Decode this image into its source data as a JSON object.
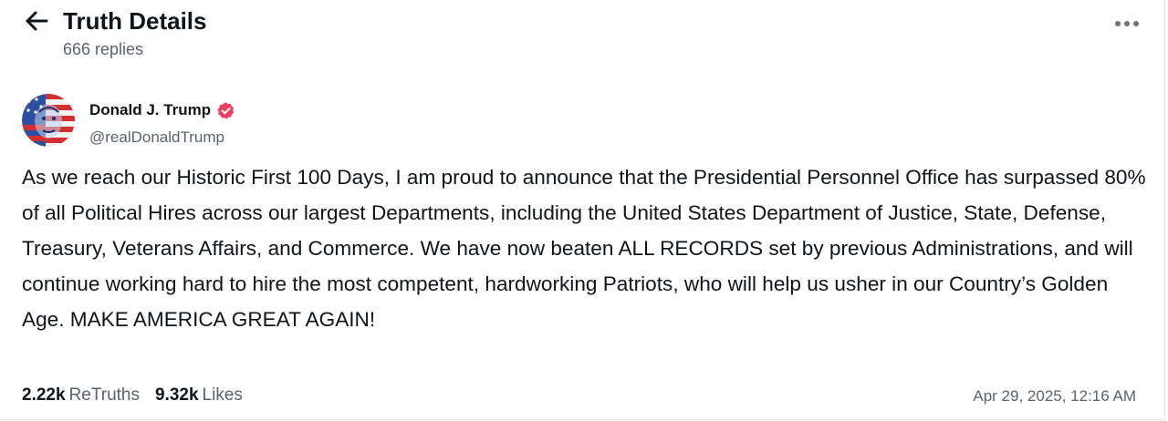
{
  "header": {
    "title": "Truth Details",
    "replies": "666 replies"
  },
  "post": {
    "author_name": "Donald J. Trump",
    "handle": "@realDonaldTrump",
    "verified_color": "#ef3e5c",
    "text": "As we reach our Historic First 100 Days, I am proud to announce that the Presidential Personnel Office has surpassed 80% of all Political Hires across our largest Departments, including the United States Department of Justice, State, Defense, Treasury, Veterans Affairs, and Commerce. We have now beaten ALL RECORDS set by previous Administrations, and will continue working hard to hire the most competent, hardworking Patriots, who will help us usher in our Country’s Golden Age. MAKE AMERICA GREAT AGAIN!",
    "retruths_count": "2.22k",
    "retruths_label": "ReTruths",
    "likes_count": "9.32k",
    "likes_label": "Likes",
    "timestamp": "Apr 29, 2025, 12:16 AM"
  },
  "icons": {
    "back": "arrow-left-icon",
    "more": "more-horizontal-icon",
    "verified": "verified-badge-icon"
  }
}
